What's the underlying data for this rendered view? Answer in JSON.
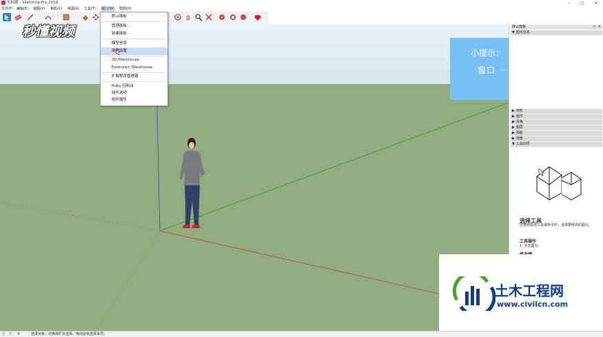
{
  "window": {
    "title": "无标题 - SketchUp Pro 2018",
    "controls": [
      "–",
      "□",
      "✕"
    ]
  },
  "menubar": [
    "文件(F)",
    "编辑(E)",
    "视图(V)",
    "相机(C)",
    "绘图(R)",
    "工具(T)",
    "窗口(W)",
    "帮助(H)"
  ],
  "dropdown": {
    "items": [
      {
        "label": "默认面板",
        "submenu": true
      },
      {
        "label": "管理面板..."
      },
      {
        "label": "新建面板..."
      },
      {
        "label": "模型信息"
      },
      {
        "label": "系统设置",
        "highlighted": true
      },
      {
        "label": "3D Warehouse"
      },
      {
        "label": "Extension Warehouse"
      },
      {
        "label": "扩展程序管理器"
      },
      {
        "label": "Ruby 控制台"
      },
      {
        "label": "组件选项"
      },
      {
        "label": "组件属性"
      }
    ]
  },
  "watermark": "秒懂视频",
  "tip": {
    "title": "小提示：",
    "body": "窗口 － 系统设置"
  },
  "panel": {
    "header": "默认面板",
    "top_section": "图元信息",
    "sections": [
      "材料",
      "组件",
      "风格",
      "图层",
      "阴影",
      "场景",
      "工具向导"
    ],
    "instructor_title": "选择工具",
    "instructor_desc": "在使用其他工具或命令时，选择要修改的图元。",
    "instructor_ops_title": "工具操作",
    "instructor_op1": "1. 点击图元。",
    "instructor_more": "修改键"
  },
  "logo": {
    "title": "土木工程网",
    "url": "www.civilcn.com",
    "colors": {
      "blue": "#0b3d8f",
      "green": "#4aa02c"
    }
  },
  "statusbar": {
    "text": "选择对象。切换到扩充选择。拖动鼠标选择多项。"
  },
  "colors": {
    "ground": "#91ad80",
    "sky_top": "#eaf3f8",
    "tip_bg": "#78bff3",
    "highlight": "#c9def5"
  }
}
